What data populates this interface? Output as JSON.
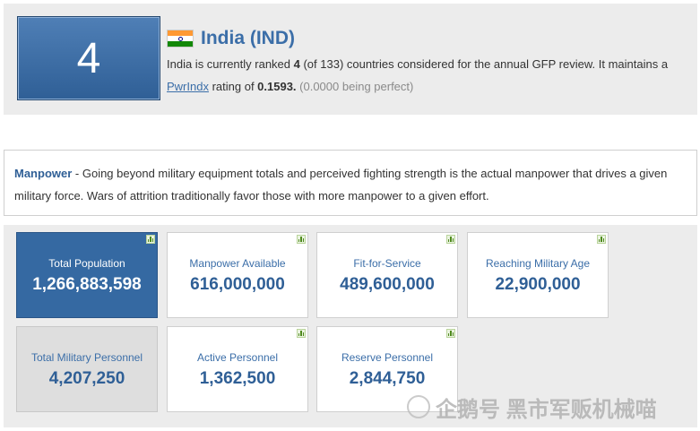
{
  "header": {
    "rank": "4",
    "country": "India (IND)",
    "flag_icon": "india-flag",
    "desc_part1": "India is currently ranked ",
    "rank_inline": "4",
    "desc_part2": " (of 133) countries considered for the annual GFP review. It maintains a",
    "pwrindx_link": "PwrIndx",
    "rating_part": " rating of ",
    "rating_value": "0.1593.",
    "perfect_note": " (0.0000 being perfect)"
  },
  "manpower": {
    "label": "Manpower",
    "description": " - Going beyond military equipment totals and perceived fighting strength is the actual manpower that drives a given military force. Wars of attrition traditionally favor those with more manpower to a given effort."
  },
  "stats": [
    {
      "label": "Total Population",
      "value": "1,266,883,598"
    },
    {
      "label": "Manpower Available",
      "value": "616,000,000"
    },
    {
      "label": "Fit-for-Service",
      "value": "489,600,000"
    },
    {
      "label": "Reaching Military Age",
      "value": "22,900,000"
    },
    {
      "label": "Total Military Personnel",
      "value": "4,207,250"
    },
    {
      "label": "Active Personnel",
      "value": "1,362,500"
    },
    {
      "label": "Reserve Personnel",
      "value": "2,844,750"
    }
  ],
  "watermark": "企鹅号 黑市军贩机械喵",
  "colors": {
    "accent": "#3b6ea8",
    "tile_active": "#3569a2",
    "tile_grey": "#dedede",
    "panel_bg": "#ececec"
  }
}
